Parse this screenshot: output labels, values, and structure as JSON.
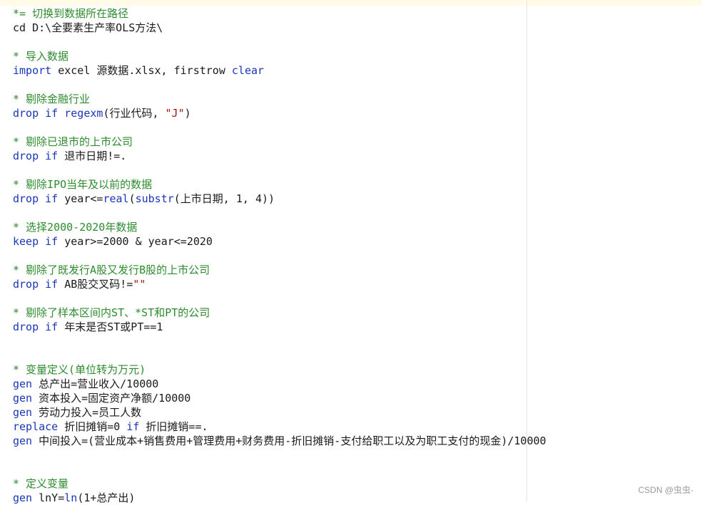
{
  "watermark": "CSDN @虫虫-",
  "colors": {
    "comment": "#2e8b2e",
    "keyword": "#1a36b8",
    "string": "#a31515",
    "text": "#1a1a1a",
    "topstrip": "#fffbe6"
  },
  "lines": [
    [
      {
        "t": "c",
        "v": "*= 切换到数据所在路径"
      }
    ],
    [
      {
        "t": "p",
        "v": "cd D:\\全要素生产率OLS方法\\"
      }
    ],
    [],
    [
      {
        "t": "c",
        "v": "* 导入数据"
      }
    ],
    [
      {
        "t": "k",
        "v": "import"
      },
      {
        "t": "p",
        "v": " excel 源数据.xlsx, firstrow "
      },
      {
        "t": "k",
        "v": "clear"
      }
    ],
    [],
    [
      {
        "t": "c",
        "v": "* 剔除金融行业"
      }
    ],
    [
      {
        "t": "k",
        "v": "drop"
      },
      {
        "t": "p",
        "v": " "
      },
      {
        "t": "k",
        "v": "if"
      },
      {
        "t": "p",
        "v": " "
      },
      {
        "t": "f",
        "v": "regexm"
      },
      {
        "t": "p",
        "v": "(行业代码, "
      },
      {
        "t": "s",
        "v": "\"J\""
      },
      {
        "t": "p",
        "v": ")"
      }
    ],
    [],
    [
      {
        "t": "c",
        "v": "* 剔除已退市的上市公司"
      }
    ],
    [
      {
        "t": "k",
        "v": "drop"
      },
      {
        "t": "p",
        "v": " "
      },
      {
        "t": "k",
        "v": "if"
      },
      {
        "t": "p",
        "v": " 退市日期!=."
      }
    ],
    [],
    [
      {
        "t": "c",
        "v": "* 剔除IPO当年及以前的数据"
      }
    ],
    [
      {
        "t": "k",
        "v": "drop"
      },
      {
        "t": "p",
        "v": " "
      },
      {
        "t": "k",
        "v": "if"
      },
      {
        "t": "p",
        "v": " year<="
      },
      {
        "t": "f",
        "v": "real"
      },
      {
        "t": "p",
        "v": "("
      },
      {
        "t": "f",
        "v": "substr"
      },
      {
        "t": "p",
        "v": "(上市日期, 1, 4))"
      }
    ],
    [],
    [
      {
        "t": "c",
        "v": "* 选择2000-2020年数据"
      }
    ],
    [
      {
        "t": "k",
        "v": "keep"
      },
      {
        "t": "p",
        "v": " "
      },
      {
        "t": "k",
        "v": "if"
      },
      {
        "t": "p",
        "v": " year>=2000 & year<=2020"
      }
    ],
    [],
    [
      {
        "t": "c",
        "v": "* 剔除了既发行A股又发行B股的上市公司"
      }
    ],
    [
      {
        "t": "k",
        "v": "drop"
      },
      {
        "t": "p",
        "v": " "
      },
      {
        "t": "k",
        "v": "if"
      },
      {
        "t": "p",
        "v": " AB股交叉码!="
      },
      {
        "t": "s",
        "v": "\"\""
      }
    ],
    [],
    [
      {
        "t": "c",
        "v": "* 剔除了样本区间内ST、*ST和PT的公司"
      }
    ],
    [
      {
        "t": "k",
        "v": "drop"
      },
      {
        "t": "p",
        "v": " "
      },
      {
        "t": "k",
        "v": "if"
      },
      {
        "t": "p",
        "v": " 年末是否ST或PT==1"
      }
    ],
    [],
    [],
    [
      {
        "t": "c",
        "v": "* 变量定义(单位转为万元)"
      }
    ],
    [
      {
        "t": "k",
        "v": "gen"
      },
      {
        "t": "p",
        "v": " 总产出=营业收入/10000"
      }
    ],
    [
      {
        "t": "k",
        "v": "gen"
      },
      {
        "t": "p",
        "v": " 资本投入=固定资产净额/10000"
      }
    ],
    [
      {
        "t": "k",
        "v": "gen"
      },
      {
        "t": "p",
        "v": " 劳动力投入=员工人数"
      }
    ],
    [
      {
        "t": "k",
        "v": "replace"
      },
      {
        "t": "p",
        "v": " 折旧摊销=0 "
      },
      {
        "t": "k",
        "v": "if"
      },
      {
        "t": "p",
        "v": " 折旧摊销==."
      }
    ],
    [
      {
        "t": "k",
        "v": "gen"
      },
      {
        "t": "p",
        "v": " 中间投入=(营业成本+销售费用+管理费用+财务费用-折旧摊销-支付给职工以及为职工支付的现金)/10000"
      }
    ],
    [],
    [],
    [
      {
        "t": "c",
        "v": "* 定义变量"
      }
    ],
    [
      {
        "t": "k",
        "v": "gen"
      },
      {
        "t": "p",
        "v": " lnY="
      },
      {
        "t": "f",
        "v": "ln"
      },
      {
        "t": "p",
        "v": "(1+总产出)"
      }
    ]
  ]
}
